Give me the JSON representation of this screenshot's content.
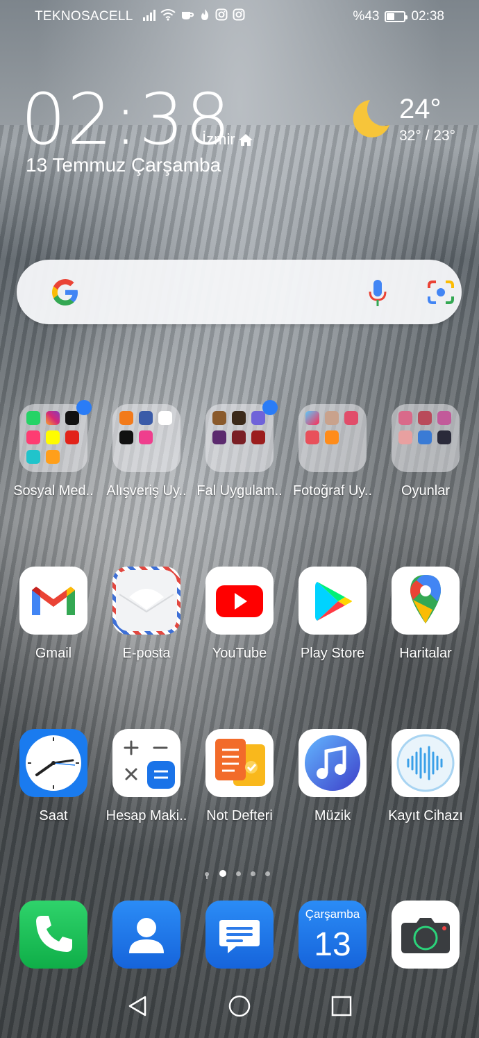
{
  "status_bar": {
    "carrier": "TEKNOSACELL",
    "battery_percent": "%43",
    "battery_level": 0.43,
    "time": "02:38",
    "icons": [
      "signal-icon",
      "wifi-icon",
      "cup-icon",
      "flame-icon",
      "instagram-icon",
      "instagram-icon"
    ]
  },
  "clock_widget": {
    "time": "02:38",
    "city": "İzmir",
    "date": "13 Temmuz Çarşamba",
    "temperature": "24°",
    "temp_range": "32° / 23°",
    "weather_icon": "moon-icon"
  },
  "search_bar": {
    "icons": [
      "google-logo",
      "mic-icon",
      "lens-icon"
    ]
  },
  "folders": [
    {
      "label": "Sosyal Med..",
      "badge": true
    },
    {
      "label": "Alışveriş Uy..",
      "badge": false
    },
    {
      "label": "Fal Uygulam..",
      "badge": true
    },
    {
      "label": "Fotoğraf Uy..",
      "badge": false
    },
    {
      "label": "Oyunlar",
      "badge": false
    }
  ],
  "apps_row1": [
    {
      "label": "Gmail",
      "icon": "gmail-icon"
    },
    {
      "label": "E-posta",
      "icon": "email-icon"
    },
    {
      "label": "YouTube",
      "icon": "youtube-icon"
    },
    {
      "label": "Play Store",
      "icon": "play-store-icon"
    },
    {
      "label": "Haritalar",
      "icon": "maps-icon"
    }
  ],
  "apps_row2": [
    {
      "label": "Saat",
      "icon": "clock-icon"
    },
    {
      "label": "Hesap Maki..",
      "icon": "calculator-icon"
    },
    {
      "label": "Not Defteri",
      "icon": "notepad-icon"
    },
    {
      "label": "Müzik",
      "icon": "music-icon"
    },
    {
      "label": "Kayıt Cihazı",
      "icon": "recorder-icon"
    }
  ],
  "dock": {
    "calendar_day": "Çarşamba",
    "calendar_date": "13",
    "icons": [
      "phone-icon",
      "contacts-icon",
      "messages-icon",
      "calendar-icon",
      "camera-icon"
    ]
  },
  "page_indicator": {
    "pages": 5,
    "current": 2
  },
  "nav_bar": {
    "icons": [
      "back-icon",
      "home-icon",
      "recents-icon"
    ]
  },
  "colors": {
    "badge": "#2a7cf6",
    "accent_blue": "#1a73e8"
  }
}
